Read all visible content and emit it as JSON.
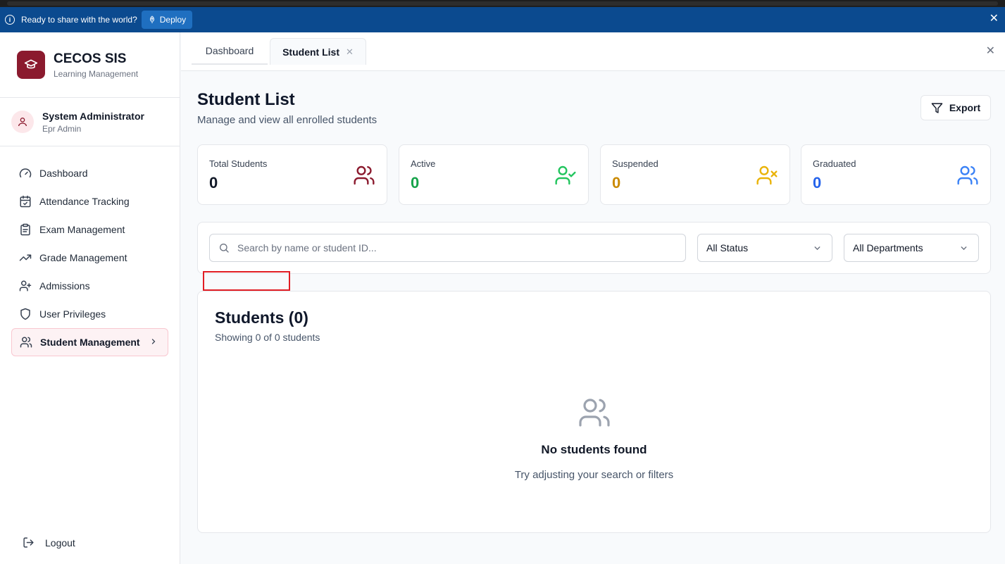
{
  "deploy_banner": {
    "message": "Ready to share with the world?",
    "deploy_label": "Deploy"
  },
  "sidebar": {
    "brand_title": "CECOS SIS",
    "brand_subtitle": "Learning Management",
    "user_name": "System Administrator",
    "user_role": "Epr Admin",
    "items": [
      {
        "label": "Dashboard",
        "icon": "gauge-icon"
      },
      {
        "label": "Attendance Tracking",
        "icon": "calendar-check-icon"
      },
      {
        "label": "Exam Management",
        "icon": "clipboard-icon"
      },
      {
        "label": "Grade Management",
        "icon": "trending-up-icon"
      },
      {
        "label": "Admissions",
        "icon": "user-plus-icon"
      },
      {
        "label": "User Privileges",
        "icon": "shield-icon"
      },
      {
        "label": "Student Management",
        "icon": "users-icon",
        "active": true
      }
    ],
    "logout_label": "Logout"
  },
  "tabs": [
    {
      "label": "Dashboard"
    },
    {
      "label": "Student List",
      "active": true
    }
  ],
  "page": {
    "title": "Student List",
    "subtitle": "Manage and view all enrolled students",
    "export_label": "Export"
  },
  "stats": [
    {
      "label": "Total Students",
      "value": "0",
      "color": "#111827",
      "icon_color": "#8b1a2e",
      "icon": "users-icon"
    },
    {
      "label": "Active",
      "value": "0",
      "color": "#16a34a",
      "icon_color": "#22c55e",
      "icon": "user-check-icon"
    },
    {
      "label": "Suspended",
      "value": "0",
      "color": "#ca8a04",
      "icon_color": "#eab308",
      "icon": "user-x-icon"
    },
    {
      "label": "Graduated",
      "value": "0",
      "color": "#2563eb",
      "icon_color": "#3b82f6",
      "icon": "users-icon"
    }
  ],
  "filters": {
    "search_placeholder": "Search by name or student ID...",
    "status_value": "All Status",
    "department_value": "All Departments"
  },
  "list": {
    "title": "Students (0)",
    "subtitle": "Showing 0 of 0 students",
    "empty_title": "No students found",
    "empty_subtitle": "Try adjusting your search or filters"
  },
  "colors": {
    "brand": "#8b1a2e",
    "banner": "#0b4a8f"
  }
}
